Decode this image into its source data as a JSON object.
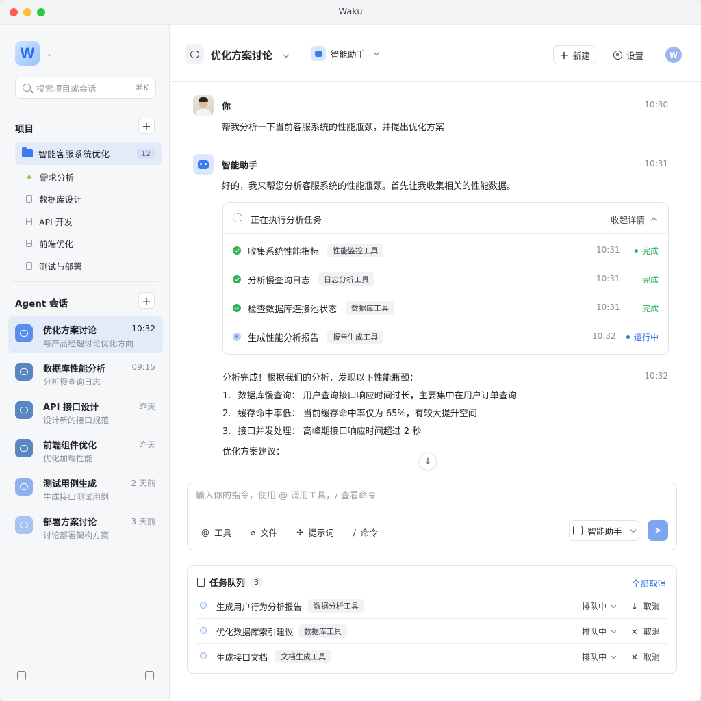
{
  "window": {
    "title": "Waku"
  },
  "sidebar": {
    "logo_letter": "W",
    "search": {
      "placeholder": "搜索项目或会话",
      "shortcut": "⌘K"
    },
    "projects_title": "项目",
    "active_project": {
      "label": "智能客服系统优化",
      "count": "12"
    },
    "project_items": [
      {
        "label": "需求分析",
        "icon": "green-dot"
      },
      {
        "label": "数据库设计",
        "icon": "doc-icon"
      },
      {
        "label": "API 开发",
        "icon": "doc-icon"
      },
      {
        "label": "前端优化",
        "icon": "doc-icon"
      },
      {
        "label": "测试与部署",
        "icon": "doc-icon"
      }
    ],
    "sessions_title": "Agent 会话",
    "sessions": [
      {
        "title": "优化方案讨论",
        "subtitle": "与产品经理讨论优化方向",
        "time": "10:32",
        "color": "#5b8def"
      },
      {
        "title": "数据库性能分析",
        "subtitle": "分析慢查询日志",
        "time": "09:15",
        "color": "#5a87c0"
      },
      {
        "title": "API 接口设计",
        "subtitle": "设计新的接口规范",
        "time": "昨天",
        "color": "#5a87c0"
      },
      {
        "title": "前端组件优化",
        "subtitle": "优化加载性能",
        "time": "昨天",
        "color": "#5a87c0"
      },
      {
        "title": "测试用例生成",
        "subtitle": "生成接口测试用例",
        "time": "2 天前",
        "color": "#8fb2ec"
      },
      {
        "title": "部署方案讨论",
        "subtitle": "讨论部署架构方案",
        "time": "3 天前",
        "color": "#a9c4f0"
      }
    ]
  },
  "header": {
    "conversation_title": "优化方案讨论",
    "agent_name": "智能助手",
    "new_label": "新建",
    "settings_label": "设置",
    "user_initial": "W"
  },
  "messages": {
    "user": {
      "name": "你",
      "time": "10:30",
      "text": "帮我分析一下当前客服系统的性能瓶颈，并提出优化方案"
    },
    "assistant": {
      "name": "智能助手",
      "time": "10:31",
      "text": "好的，我来帮您分析客服系统的性能瓶颈。首先让我收集相关的性能数据。"
    }
  },
  "task_card": {
    "title": "正在执行分析任务",
    "collapse_label": "收起详情",
    "steps": [
      {
        "name": "收集系统性能指标",
        "tool": "性能监控工具",
        "time": "10:31",
        "status": "完成"
      },
      {
        "name": "分析慢查询日志",
        "tool": "日志分析工具",
        "time": "10:31",
        "status": "完成"
      },
      {
        "name": "检查数据库连接池状态",
        "tool": "数据库工具",
        "time": "10:31",
        "status": "完成"
      },
      {
        "name": "生成性能分析报告",
        "tool": "报告生成工具",
        "time": "10:32",
        "status": "运行中"
      }
    ]
  },
  "result": {
    "intro": "分析完成！根据我们的分析，发现以下性能瓶颈：",
    "time": "10:32",
    "points": [
      {
        "num": "1.",
        "label": "数据库慢查询：",
        "text": "用户查询接口响应时间过长，主要集中在用户订单查询"
      },
      {
        "num": "2.",
        "label": "缓存命中率低：",
        "text": "当前缓存命中率仅为 65%，有较大提升空间"
      },
      {
        "num": "3.",
        "label": "接口并发处理：",
        "text": "高峰期接口响应时间超过 2 秒"
      }
    ],
    "suggestion_title": "优化方案建议："
  },
  "composer": {
    "placeholder": "输入你的指令，使用 @ 调用工具，/ 查看命令",
    "tools": [
      {
        "label": "工具",
        "icon": "at-icon"
      },
      {
        "label": "文件",
        "icon": "paperclip-icon"
      },
      {
        "label": "提示词",
        "icon": "puzzle-icon"
      },
      {
        "label": "命令",
        "icon": "slash-icon"
      }
    ],
    "agent_label": "智能助手"
  },
  "queue": {
    "title": "任务队列",
    "count": "3",
    "cancel_all": "全部取消",
    "items": [
      {
        "name": "生成用户行为分析报告",
        "tool": "数据分析工具",
        "status": "排队中",
        "action": "取消",
        "action_icon": "arrow-down-icon"
      },
      {
        "name": "优化数据库索引建议",
        "tool": "数据库工具",
        "status": "排队中",
        "action": "取消",
        "action_icon": "close-icon"
      },
      {
        "name": "生成接口文档",
        "tool": "文档生成工具",
        "status": "排队中",
        "action": "取消",
        "action_icon": "close-icon"
      }
    ]
  },
  "colors": {
    "accent": "#2b6de8",
    "success": "#2fb35b",
    "active_bg": "#e3ebf8"
  }
}
